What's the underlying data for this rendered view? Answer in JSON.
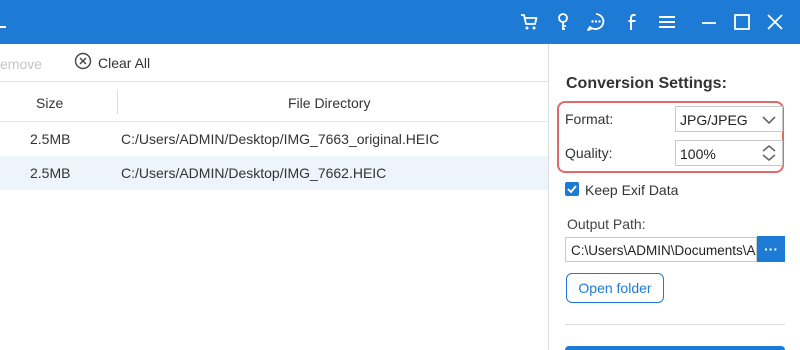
{
  "titlebar": {
    "icons": [
      "cart-icon",
      "key-icon",
      "chat-icon",
      "facebook-icon",
      "menu-icon",
      "minimize-icon",
      "maximize-icon",
      "close-icon"
    ]
  },
  "toolbar": {
    "remove_label": "emove",
    "clear_all_label": "Clear All"
  },
  "table": {
    "columns": [
      "Size",
      "File Directory"
    ],
    "rows": [
      {
        "size": "2.5MB",
        "path": "C:/Users/ADMIN/Desktop/IMG_7663_original.HEIC"
      },
      {
        "size": "2.5MB",
        "path": "C:/Users/ADMIN/Desktop/IMG_7662.HEIC"
      }
    ]
  },
  "settings": {
    "title": "Conversion Settings:",
    "format_label": "Format:",
    "format_value": "JPG/JPEG",
    "quality_label": "Quality:",
    "quality_value": "100%",
    "keep_exif_label": "Keep Exif Data",
    "keep_exif_checked": true,
    "output_path_label": "Output Path:",
    "output_path_value": "C:\\Users\\ADMIN\\Documents\\Aiseesoft Studio",
    "browse_label": "···",
    "open_folder_label": "Open folder"
  },
  "colors": {
    "accent": "#1d7bd6",
    "highlight": "#e06a6a",
    "row_alt": "#eef4fb"
  }
}
